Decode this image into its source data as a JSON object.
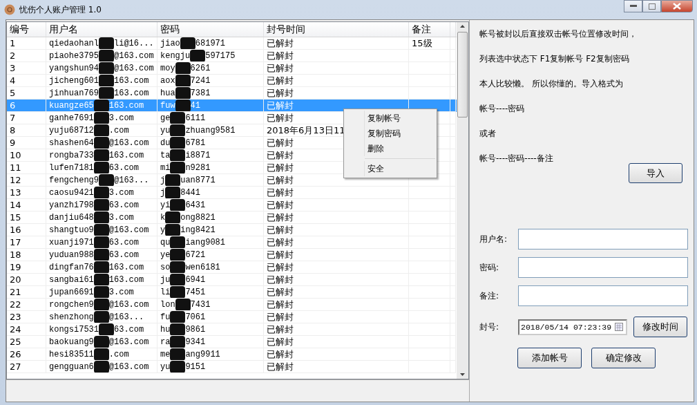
{
  "window": {
    "title": "忧伤个人账户管理 1.0"
  },
  "table": {
    "columns": [
      "编号",
      "用户名",
      "密码",
      "封号时间",
      "备注"
    ],
    "rows": [
      {
        "no": "1",
        "user": [
          "qiedaohanl",
          "li@16..."
        ],
        "pass": [
          "jiao",
          "681971"
        ],
        "time": "已解封",
        "note": "15级",
        "selected": false
      },
      {
        "no": "2",
        "user": [
          "piaohe3795",
          "@163.com"
        ],
        "pass": [
          "kengju",
          "597175"
        ],
        "time": "已解封",
        "selected": false
      },
      {
        "no": "3",
        "user": [
          "yangshun94",
          "@163.com"
        ],
        "pass": [
          "moy",
          "6261"
        ],
        "time": "已解封",
        "selected": false
      },
      {
        "no": "4",
        "user": [
          "jicheng601",
          "163.com"
        ],
        "pass": [
          "aox",
          "7241"
        ],
        "time": "已解封",
        "selected": false
      },
      {
        "no": "5",
        "user": [
          "jinhuan769",
          "163.com"
        ],
        "pass": [
          "hua",
          "7381"
        ],
        "time": "已解封",
        "selected": false
      },
      {
        "no": "6",
        "user": [
          "kuangze65",
          "163.com"
        ],
        "pass": [
          "fuw",
          "41"
        ],
        "time": "已解封",
        "selected": true
      },
      {
        "no": "7",
        "user": [
          "ganhe7691",
          "3.com"
        ],
        "pass": [
          "ge",
          "6111"
        ],
        "time": "已解封",
        "selected": false
      },
      {
        "no": "8",
        "user": [
          "yuju68712",
          ".com"
        ],
        "pass": [
          "yu",
          "zhuang9581"
        ],
        "time": "2018年6月13日11",
        "selected": false
      },
      {
        "no": "9",
        "user": [
          "shashen64",
          "@163.com"
        ],
        "pass": [
          "du",
          "6781"
        ],
        "time": "已解封",
        "selected": false
      },
      {
        "no": "10",
        "user": [
          "rongba733",
          "163.com"
        ],
        "pass": [
          "ta",
          "i8871"
        ],
        "time": "已解封",
        "selected": false
      },
      {
        "no": "11",
        "user": [
          "lufen7181",
          "63.com"
        ],
        "pass": [
          "mi",
          "n9281"
        ],
        "time": "已解封",
        "selected": false
      },
      {
        "no": "12",
        "user": [
          "fengcheng9",
          "@163..."
        ],
        "pass": [
          "j",
          "uan8771"
        ],
        "time": "已解封",
        "selected": false
      },
      {
        "no": "13",
        "user": [
          "caosu9421",
          "3.com"
        ],
        "pass": [
          "j",
          "8441"
        ],
        "time": "已解封",
        "selected": false
      },
      {
        "no": "14",
        "user": [
          "yanzhi798",
          "63.com"
        ],
        "pass": [
          "yi",
          "6431"
        ],
        "time": "已解封",
        "selected": false
      },
      {
        "no": "15",
        "user": [
          "danjiu648",
          "3.com"
        ],
        "pass": [
          "k",
          "ong8821"
        ],
        "time": "已解封",
        "selected": false
      },
      {
        "no": "16",
        "user": [
          "shangtuo9",
          "@163.com"
        ],
        "pass": [
          "y",
          "ing8421"
        ],
        "time": "已解封",
        "selected": false
      },
      {
        "no": "17",
        "user": [
          "xuanji971",
          "63.com"
        ],
        "pass": [
          "qu",
          "iang9081"
        ],
        "time": "已解封",
        "selected": false
      },
      {
        "no": "18",
        "user": [
          "yuduan988",
          "63.com"
        ],
        "pass": [
          "ye",
          "6721"
        ],
        "time": "已解封",
        "selected": false
      },
      {
        "no": "19",
        "user": [
          "dingfan76",
          "163.com"
        ],
        "pass": [
          "so",
          "wen6181"
        ],
        "time": "已解封",
        "selected": false
      },
      {
        "no": "20",
        "user": [
          "sangbai61",
          "163.com"
        ],
        "pass": [
          "ju",
          "6941"
        ],
        "time": "已解封",
        "selected": false
      },
      {
        "no": "21",
        "user": [
          "jupan6691",
          "3.com"
        ],
        "pass": [
          "li",
          "7451"
        ],
        "time": "已解封",
        "selected": false
      },
      {
        "no": "22",
        "user": [
          "rongchen9",
          "@163.com"
        ],
        "pass": [
          "lon",
          "7431"
        ],
        "time": "已解封",
        "selected": false
      },
      {
        "no": "23",
        "user": [
          "shenzhong",
          "@163..."
        ],
        "pass": [
          "fu",
          "7061"
        ],
        "time": "已解封",
        "selected": false
      },
      {
        "no": "24",
        "user": [
          "kongsi7531",
          "63.com"
        ],
        "pass": [
          "hu",
          "9861"
        ],
        "time": "已解封",
        "selected": false
      },
      {
        "no": "25",
        "user": [
          "baokuang9",
          "@163.com"
        ],
        "pass": [
          "ra",
          "9341"
        ],
        "time": "已解封",
        "selected": false
      },
      {
        "no": "26",
        "user": [
          "hesi83511",
          ".com"
        ],
        "pass": [
          "me",
          "ang9911"
        ],
        "time": "已解封",
        "selected": false
      },
      {
        "no": "27",
        "user": [
          "gengguan6",
          "@163.com"
        ],
        "pass": [
          "yu",
          "9151"
        ],
        "time": "已解封",
        "selected": false
      }
    ]
  },
  "context_menu": {
    "items": [
      {
        "label": "复制帐号",
        "kind": "item"
      },
      {
        "label": "复制密码",
        "kind": "item"
      },
      {
        "label": "删除",
        "kind": "item"
      },
      {
        "kind": "separator"
      },
      {
        "label": "安全",
        "kind": "item"
      }
    ]
  },
  "help_lines": [
    "帐号被封以后直接双击帐号位置修改时间，",
    "列表选中状态下 F1复制帐号 F2复制密码",
    "本人比较懒。 所以你懂的。导入格式为",
    "帐号----密码",
    "或者",
    "帐号----密码----备注"
  ],
  "import_button": "导入",
  "form": {
    "username_label": "用户名:",
    "password_label": "密码:",
    "note_label": "备注:",
    "ban_label": "封号:",
    "ban_time": "2018/05/14 07:23:39",
    "change_time_button": "修改时间",
    "add_button": "添加帐号",
    "confirm_button": "确定修改"
  }
}
